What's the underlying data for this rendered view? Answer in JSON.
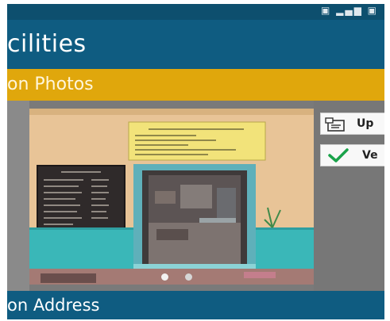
{
  "app": {
    "title": "cilities"
  },
  "section": {
    "label": "on Photos"
  },
  "photo_carousel": {
    "slide_count": 2,
    "active_index": 0
  },
  "actions": {
    "upload_label": "Up",
    "verify_label": "Ve"
  },
  "footer": {
    "label": "on Address"
  },
  "colors": {
    "app_bar": "#0f5c81",
    "status_bar": "#0d4f6e",
    "section_bar": "#e0a70c",
    "check": "#1aa34a"
  },
  "icons": {
    "status": "network-signal-icon",
    "upload": "upload-document-icon",
    "verify": "checkmark-icon"
  }
}
